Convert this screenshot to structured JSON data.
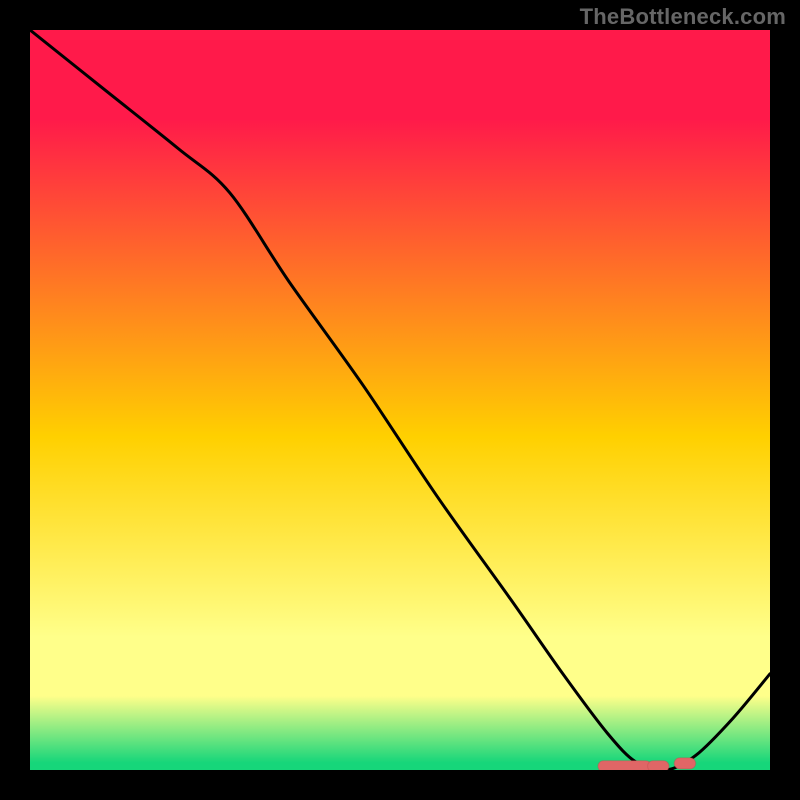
{
  "watermark": "TheBottleneck.com",
  "colors": {
    "background": "#000000",
    "gradient_top": "#ff1a4a",
    "gradient_mid": "#ffd000",
    "gradient_yellowish": "#ffff8a",
    "gradient_green": "#16d67a",
    "curve": "#000000",
    "marker_fill": "#e06666",
    "marker_stroke": "#c04a4a"
  },
  "chart_data": {
    "type": "line",
    "title": "",
    "xlabel": "",
    "ylabel": "",
    "xlim": [
      0,
      100
    ],
    "ylim": [
      0,
      100
    ],
    "series": [
      {
        "name": "curve",
        "x": [
          0,
          10,
          20,
          27,
          35,
          45,
          55,
          65,
          72,
          78,
          82,
          86,
          90,
          95,
          100
        ],
        "y": [
          100,
          92,
          84,
          78,
          66,
          52,
          37,
          23,
          13,
          5,
          1,
          0,
          2,
          7,
          13
        ]
      }
    ],
    "marker_cluster": {
      "name": "bottom-cluster",
      "shape": "pill",
      "segments": [
        {
          "x_start": 77.5,
          "x_end": 83.2,
          "y": 0.5
        },
        {
          "x_start": 84.2,
          "x_end": 85.6,
          "y": 0.5
        },
        {
          "x_start": 87.8,
          "x_end": 89.2,
          "y": 0.9
        }
      ]
    },
    "gradient_bands_percent_from_top": [
      {
        "color_key": "gradient_top",
        "stop": 0
      },
      {
        "color_key": "gradient_top",
        "stop": 12
      },
      {
        "color_key": "gradient_mid",
        "stop": 55
      },
      {
        "color_key": "gradient_yellowish",
        "stop": 82
      },
      {
        "color_key": "gradient_yellowish",
        "stop": 90
      },
      {
        "color_key": "gradient_green",
        "stop": 99
      },
      {
        "color_key": "gradient_green",
        "stop": 100
      }
    ]
  }
}
